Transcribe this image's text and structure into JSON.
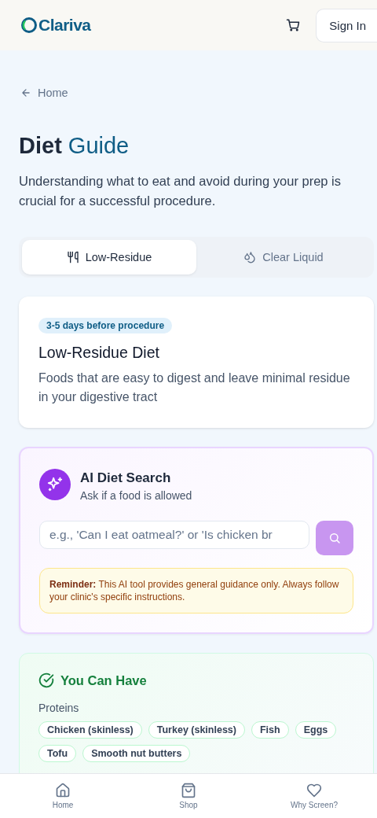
{
  "header": {
    "logo": "Clariva",
    "sign_in": "Sign In"
  },
  "back_link": "Home",
  "title": "**Diet** Guide",
  "subtitle": "Understanding what to eat and avoid during your prep is crucial for a successful procedure.",
  "tabs": [
    {
      "label": "Low-Residue",
      "kind": "utensils",
      "selected": true
    },
    {
      "label": "Clear Liquid",
      "kind": "drops",
      "selected": false
    }
  ],
  "info_card": {
    "badge": "3-5 days before procedure",
    "heading": "Low-Residue Diet",
    "description": "Foods that are easy to digest and leave minimal residue in your digestive tract"
  },
  "ai_search": {
    "heading": "AI Diet Search",
    "subheading": "Ask if a food is allowed",
    "placeholder": "e.g., 'Can I eat oatmeal?' or 'Is chicken br",
    "button_disabled": true,
    "reminder": "**Reminder:** This AI tool provides general guidance only. Always follow your clinic's specific instructions."
  },
  "allowed": {
    "heading": "You Can Have",
    "groups": [
      {
        "name": "Proteins",
        "items": [
          "Chicken (skinless)",
          "Turkey (skinless)",
          "Fish",
          "Eggs",
          "Tofu",
          "Smooth nut butters"
        ]
      }
    ]
  },
  "bottom_nav": [
    {
      "label": "Home",
      "kind": "home"
    },
    {
      "label": "Shop",
      "kind": "bag"
    },
    {
      "label": "Why Screen?",
      "kind": "heart"
    }
  ]
}
